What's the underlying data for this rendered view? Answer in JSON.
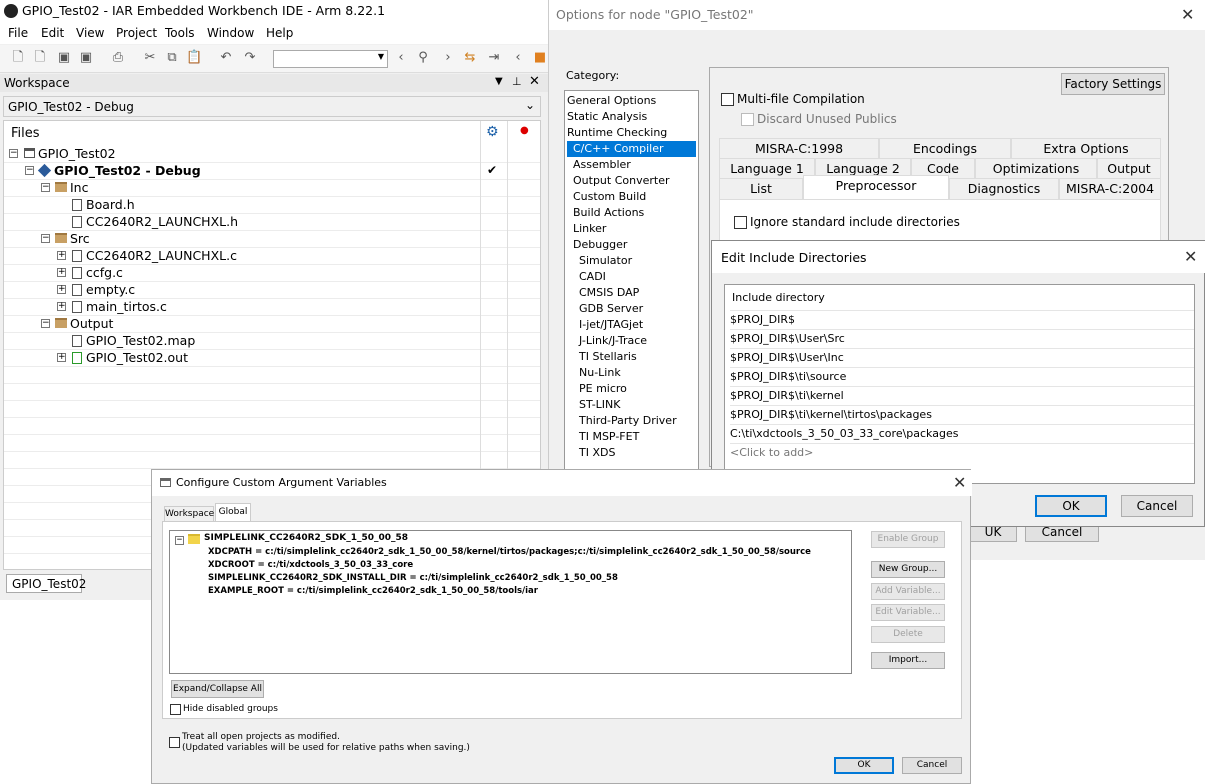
{
  "ide": {
    "title": "GPIO_Test02 - IAR Embedded Workbench IDE - Arm 8.22.1",
    "menu": [
      "File",
      "Edit",
      "View",
      "Project",
      "Tools",
      "Window",
      "Help"
    ],
    "workspace_label": "Workspace",
    "config_select": "GPIO_Test02 - Debug",
    "files_header": "Files",
    "tree": [
      {
        "label": "GPIO_Test02",
        "level": 0,
        "icon": "workspace-icon"
      },
      {
        "label": "GPIO_Test02 - Debug",
        "level": 1,
        "icon": "project-icon",
        "bold": true,
        "check": "✔"
      },
      {
        "label": "Inc",
        "level": 2,
        "icon": "folder-icon"
      },
      {
        "label": "Board.h",
        "level": 3,
        "icon": "header-file-icon"
      },
      {
        "label": "CC2640R2_LAUNCHXL.h",
        "level": 3,
        "icon": "header-file-icon"
      },
      {
        "label": "Src",
        "level": 2,
        "icon": "folder-icon"
      },
      {
        "label": "CC2640R2_LAUNCHXL.c",
        "level": 3,
        "icon": "c-file-icon"
      },
      {
        "label": "ccfg.c",
        "level": 3,
        "icon": "c-file-icon"
      },
      {
        "label": "empty.c",
        "level": 3,
        "icon": "c-file-icon"
      },
      {
        "label": "main_tirtos.c",
        "level": 3,
        "icon": "c-file-icon"
      },
      {
        "label": "Output",
        "level": 2,
        "icon": "folder-icon"
      },
      {
        "label": "GPIO_Test02.map",
        "level": 3,
        "icon": "map-file-icon"
      },
      {
        "label": "GPIO_Test02.out",
        "level": 3,
        "icon": "out-file-icon"
      }
    ],
    "bottom_tab": "GPIO_Test02"
  },
  "options": {
    "title": "Options for node \"GPIO_Test02\"",
    "category_label": "Category:",
    "categories": [
      {
        "label": "General Options",
        "indent": 0
      },
      {
        "label": "Static Analysis",
        "indent": 0
      },
      {
        "label": "Runtime Checking",
        "indent": 0
      },
      {
        "label": "C/C++ Compiler",
        "indent": 1,
        "selected": true
      },
      {
        "label": "Assembler",
        "indent": 1
      },
      {
        "label": "Output Converter",
        "indent": 1
      },
      {
        "label": "Custom Build",
        "indent": 1
      },
      {
        "label": "Build Actions",
        "indent": 1
      },
      {
        "label": "Linker",
        "indent": 1
      },
      {
        "label": "Debugger",
        "indent": 1
      },
      {
        "label": "Simulator",
        "indent": 2
      },
      {
        "label": "CADI",
        "indent": 2
      },
      {
        "label": "CMSIS DAP",
        "indent": 2
      },
      {
        "label": "GDB Server",
        "indent": 2
      },
      {
        "label": "I-jet/JTAGjet",
        "indent": 2
      },
      {
        "label": "J-Link/J-Trace",
        "indent": 2
      },
      {
        "label": "TI Stellaris",
        "indent": 2
      },
      {
        "label": "Nu-Link",
        "indent": 2
      },
      {
        "label": "PE micro",
        "indent": 2
      },
      {
        "label": "ST-LINK",
        "indent": 2
      },
      {
        "label": "Third-Party Driver",
        "indent": 2
      },
      {
        "label": "TI MSP-FET",
        "indent": 2
      },
      {
        "label": "TI XDS",
        "indent": 2
      }
    ],
    "factory_settings": "Factory Settings",
    "multifile": "Multi-file Compilation",
    "discard_unused": "Discard Unused Publics",
    "tabs_row1": [
      "MISRA-C:1998",
      "Encodings",
      "Extra Options"
    ],
    "tabs_row2": [
      "Language 1",
      "Language 2",
      "Code",
      "Optimizations",
      "Output"
    ],
    "tabs_row3": [
      "List",
      "Preprocessor",
      "Diagnostics",
      "MISRA-C:2004"
    ],
    "ignore_std": "Ignore standard include directories",
    "ok_partial": "UK",
    "cancel_partial": "Cancel"
  },
  "include_dlg": {
    "title": "Edit Include Directories",
    "header": "Include directory",
    "rows": [
      "$PROJ_DIR$",
      "$PROJ_DIR$\\User\\Src",
      "$PROJ_DIR$\\User\\Inc",
      "$PROJ_DIR$\\ti\\source",
      "$PROJ_DIR$\\ti\\kernel",
      "$PROJ_DIR$\\ti\\kernel\\tirtos\\packages",
      "C:\\ti\\xdctools_3_50_03_33_core\\packages"
    ],
    "add_hint": "<Click to add>",
    "ok": "OK",
    "cancel": "Cancel"
  },
  "args_dlg": {
    "title": "Configure Custom Argument Variables",
    "tabs": [
      "Workspace",
      "Global"
    ],
    "group": "SIMPLELINK_CC2640R2_SDK_1_50_00_58",
    "vars": [
      "XDCPATH = c:/ti/simplelink_cc2640r2_sdk_1_50_00_58/kernel/tirtos/packages;c:/ti/simplelink_cc2640r2_sdk_1_50_00_58/source",
      "XDCROOT = c:/ti/xdctools_3_50_03_33_core",
      "SIMPLELINK_CC2640R2_SDK_INSTALL_DIR = c:/ti/simplelink_cc2640r2_sdk_1_50_00_58",
      "EXAMPLE_ROOT = c:/ti/simplelink_cc2640r2_sdk_1_50_00_58/tools/iar"
    ],
    "buttons": {
      "enable_group": "Enable Group",
      "new_group": "New Group...",
      "add_variable": "Add Variable...",
      "edit_variable": "Edit Variable...",
      "delete": "Delete",
      "import": "Import..."
    },
    "expand_collapse": "Expand/Collapse All",
    "hide_disabled": "Hide disabled groups",
    "treat_all": "Treat all open projects as modified.",
    "treat_all_note": "(Updated variables will be used for relative paths when saving.)",
    "ok": "OK",
    "cancel": "Cancel"
  }
}
